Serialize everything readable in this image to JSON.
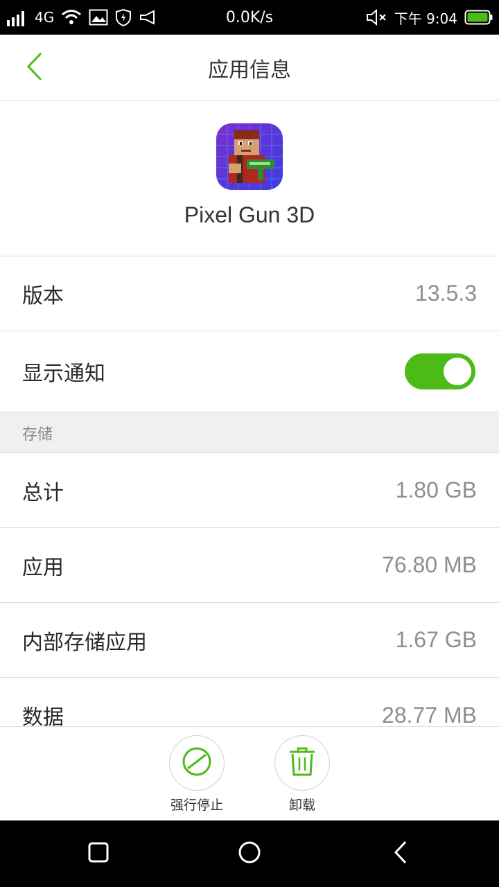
{
  "status_bar": {
    "sim_slot": "1",
    "network": "4G",
    "speed": "0.0K/s",
    "time": "下午 9:04",
    "icons": [
      "signal-icon",
      "wifi-icon",
      "image-icon",
      "shield-icon",
      "megaphone-icon",
      "mute-icon",
      "battery-icon"
    ]
  },
  "app_bar": {
    "title": "应用信息",
    "back_icon": "chevron-left-icon"
  },
  "app": {
    "name": "Pixel Gun 3D",
    "icon": "pixel-gun-app-icon"
  },
  "info": {
    "version_label": "版本",
    "version_value": "13.5.3",
    "notify_label": "显示通知",
    "notify_enabled": true
  },
  "storage": {
    "section_label": "存储",
    "rows": [
      {
        "label": "总计",
        "value": "1.80 GB"
      },
      {
        "label": "应用",
        "value": "76.80 MB"
      },
      {
        "label": "内部存储应用",
        "value": "1.67 GB"
      },
      {
        "label": "数据",
        "value": "28.77 MB"
      }
    ]
  },
  "actions": {
    "force_stop": "强行停止",
    "uninstall": "卸载"
  },
  "colors": {
    "accent": "#4cbb17",
    "status_bar": "#000000",
    "nav_bar": "#000000"
  },
  "nav": {
    "icons": [
      "recents-icon",
      "home-icon",
      "back-icon"
    ]
  }
}
